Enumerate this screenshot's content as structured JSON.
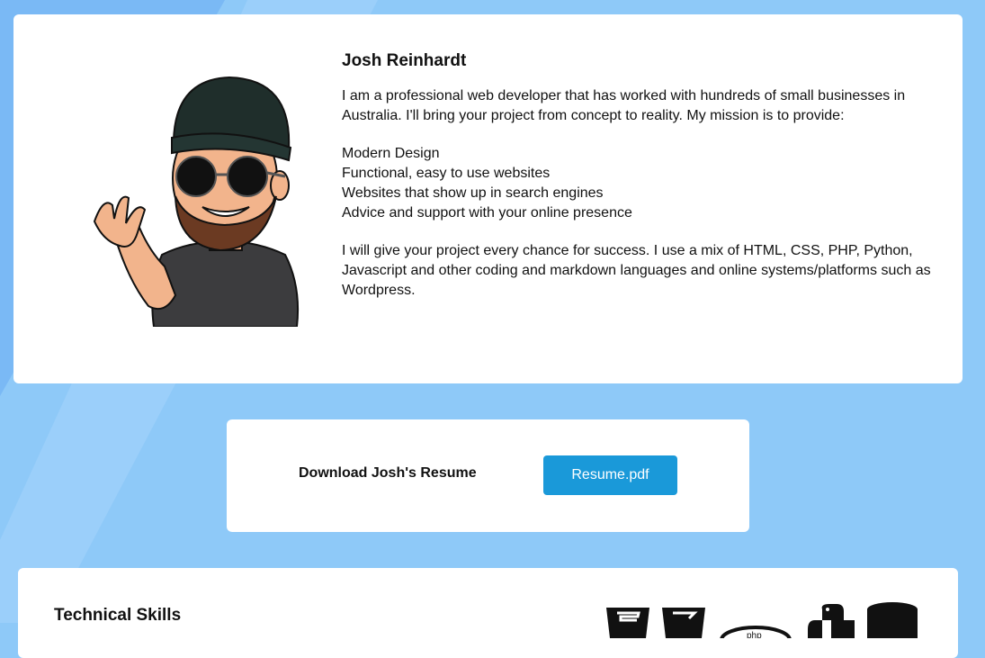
{
  "profile": {
    "name": "Josh Reinhardt",
    "intro": "I am a professional web developer that has worked with hundreds of small businesses in Australia. I'll bring your project from concept to reality. My mission is to provide:",
    "provides": [
      "Modern Design",
      "Functional, easy to use websites",
      "Websites that show up in search engines",
      "Advice and support with your online presence"
    ],
    "closing": "I will give your project every chance for success. I use a mix of HTML, CSS, PHP, Python, Javascript and other coding and markdown languages and online systems/platforms such as Wordpress."
  },
  "resume": {
    "label": "Download Josh's Resume",
    "button": "Resume.pdf"
  },
  "skills": {
    "title": "Technical Skills",
    "icons": [
      "html5-icon",
      "css3-icon",
      "php-icon",
      "python-icon",
      "database-icon"
    ]
  },
  "colors": {
    "background": "#8ec9f8",
    "accent": "#1a99d9",
    "card": "#ffffff"
  }
}
